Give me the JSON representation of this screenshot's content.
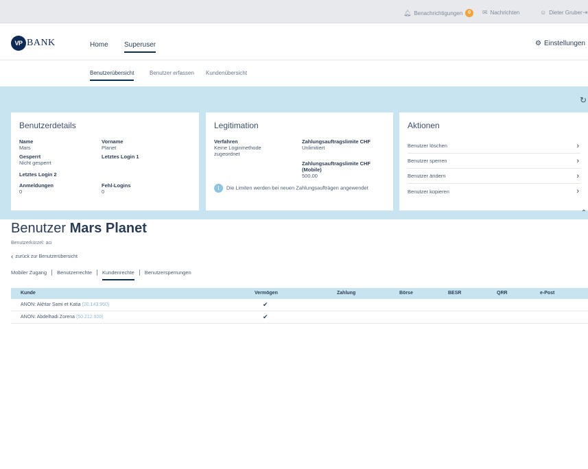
{
  "topbar": {
    "notifications_label": "Benachrichtigungen",
    "notifications_count": "0",
    "messages_label": "Nachrichten",
    "user_name": "Dieter Gruber"
  },
  "header": {
    "logo_mark": "VP",
    "logo_text": "BANK",
    "nav": [
      "Home",
      "Superuser"
    ],
    "settings_label": "Einstellungen"
  },
  "subnav": [
    "Benutzerübersicht",
    "Benutzer erfassen",
    "Kundenübersicht"
  ],
  "details": {
    "title": "Benutzerdetails",
    "name_label": "Name",
    "name_value": "Mars",
    "firstname_label": "Vorname",
    "firstname_value": "Planet",
    "blocked_label": "Gesperrt",
    "blocked_value": "Nicht gesperrt",
    "lastlogin1_label": "Letztes Login 1",
    "lastlogin2_label": "Letztes Login 2",
    "logins_label": "Anmeldungen",
    "logins_value": "0",
    "faillogins_label": "Fehl-Logins",
    "faillogins_value": "0"
  },
  "legitimation": {
    "title": "Legitimation",
    "method_label": "Verfahren",
    "method_value": "Keine Loginmethode zugeordnet",
    "limit_label": "Zahlungsauftragslimite CHF",
    "limit_value": "Unlimitiert",
    "limit_mobile_label": "Zahlungsauftragslimite CHF (Mobile)",
    "limit_mobile_value": "500.00",
    "info_text": "Die Limiten werden bei neuen Zahlungsaufträgen angewendet"
  },
  "actions": {
    "title": "Aktionen",
    "items": [
      "Benutzer löschen",
      "Benutzer sperren",
      "Benutzer ändern",
      "Benutzer kopieren"
    ]
  },
  "user": {
    "title_prefix": "Benutzer",
    "title_name": "Mars Planet",
    "shortname": "Benutzerkürzel: aci",
    "back_label": "zurück zur Benutzerübersicht"
  },
  "tabs": [
    "Mobiler Zugang",
    "Benutzerrechte",
    "Kundenrechte",
    "Benutzersperrungen"
  ],
  "table": {
    "columns": [
      "Kunde",
      "Vermögen",
      "Zahlung",
      "Börse",
      "BESR",
      "QRR",
      "e-Post"
    ],
    "rows": [
      {
        "kunde": "ANON: Akhtar Sami et Katia",
        "nummer": "(20.143.960)",
        "vermoegen": "✔"
      },
      {
        "kunde": "ANON: Abdelhadi Zorena",
        "nummer": "(50.212.920)",
        "vermoegen": "✔"
      }
    ]
  },
  "icons": {
    "notifications": "bell-icon",
    "messages": "envelope-icon",
    "user": "user-icon",
    "settings": "gear-icon",
    "refresh": "refresh-icon",
    "info": "info-icon",
    "chevron": "chevron-right-icon",
    "collapse": "chevron-up-icon",
    "back": "chevron-left-icon",
    "check": "checkmark-icon"
  },
  "colors": {
    "brand": "#0d2a54",
    "band": "#c9e4f1",
    "badge": "#f2a33a"
  }
}
